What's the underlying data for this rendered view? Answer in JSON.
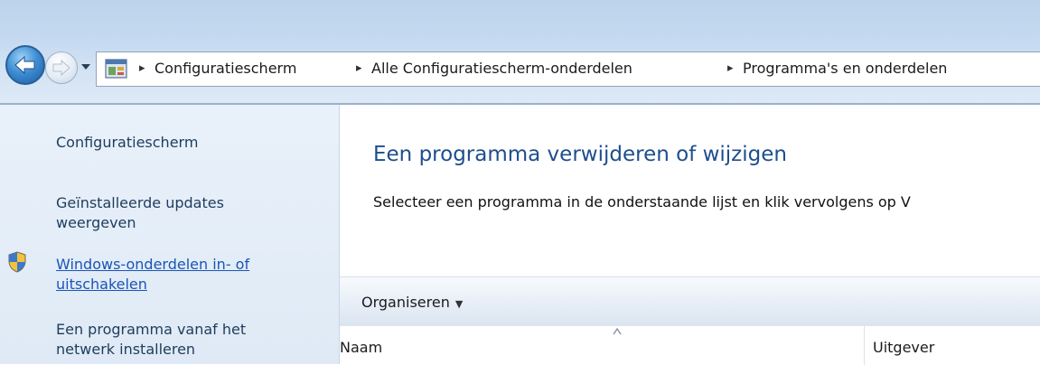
{
  "navigation": {
    "back_icon": "back-arrow-icon",
    "forward_icon": "forward-arrow-icon",
    "dropdown_icon": "chevron-down-icon"
  },
  "address": {
    "icon": "control-panel-icon",
    "separator": "▸",
    "crumbs": [
      "Configuratiescherm",
      "Alle Configuratiescherm-onderdelen",
      "Programma's en onderdelen"
    ]
  },
  "sidebar": {
    "items": [
      {
        "label": "Configuratiescherm"
      },
      {
        "label": "Geïnstalleerde updates",
        "label2": "weergeven"
      },
      {
        "label": "Windows-onderdelen in- of",
        "label2": "uitschakelen",
        "icon": "shield-icon"
      },
      {
        "label": "Een programma vanaf het",
        "label2": "netwerk installeren"
      }
    ]
  },
  "main": {
    "title": "Een programma verwijderen of wijzigen",
    "description": "Selecteer een programma in de onderstaande lijst en klik vervolgens op V"
  },
  "toolbar": {
    "organize_label": "Organiseren",
    "organize_caret": "▼"
  },
  "list": {
    "columns": [
      "Naam",
      "Uitgever"
    ]
  },
  "colors": {
    "title_blue": "#1e4e8c",
    "link_blue": "#1a55b5",
    "sidebar_bg": "#e4eef8"
  }
}
